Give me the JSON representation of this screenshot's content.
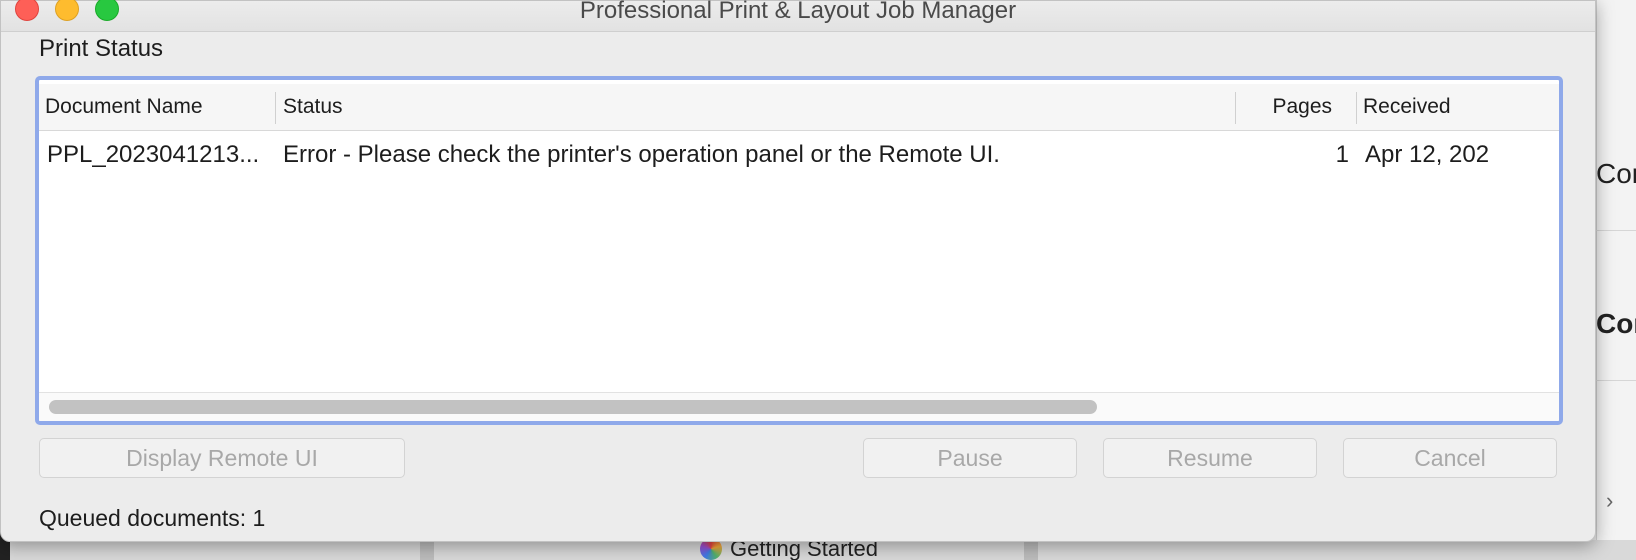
{
  "window": {
    "title": "Professional Print & Layout Job Manager"
  },
  "section_label": "Print Status",
  "table": {
    "columns": [
      {
        "key": "document_name",
        "label": "Document Name"
      },
      {
        "key": "status",
        "label": "Status"
      },
      {
        "key": "pages",
        "label": "Pages"
      },
      {
        "key": "received",
        "label": "Received"
      }
    ],
    "rows": [
      {
        "document_name": "PPL_2023041213...",
        "status": "Error - Please check the printer's operation panel or the Remote UI.",
        "pages": "1",
        "received": "Apr 12, 202"
      }
    ]
  },
  "buttons": {
    "display_remote_ui": "Display Remote UI",
    "pause": "Pause",
    "resume": "Resume",
    "cancel": "Cancel"
  },
  "footer": {
    "queued_documents": "Queued documents: 1"
  },
  "background": {
    "right_text_1": "Con",
    "right_text_2": "Con",
    "chevron": "›",
    "getting_started": "Getting Started"
  },
  "colors": {
    "close": "#fe5f57",
    "minimize": "#febc2e",
    "zoom": "#28c840",
    "focus_ring": "#8fa9ea"
  }
}
